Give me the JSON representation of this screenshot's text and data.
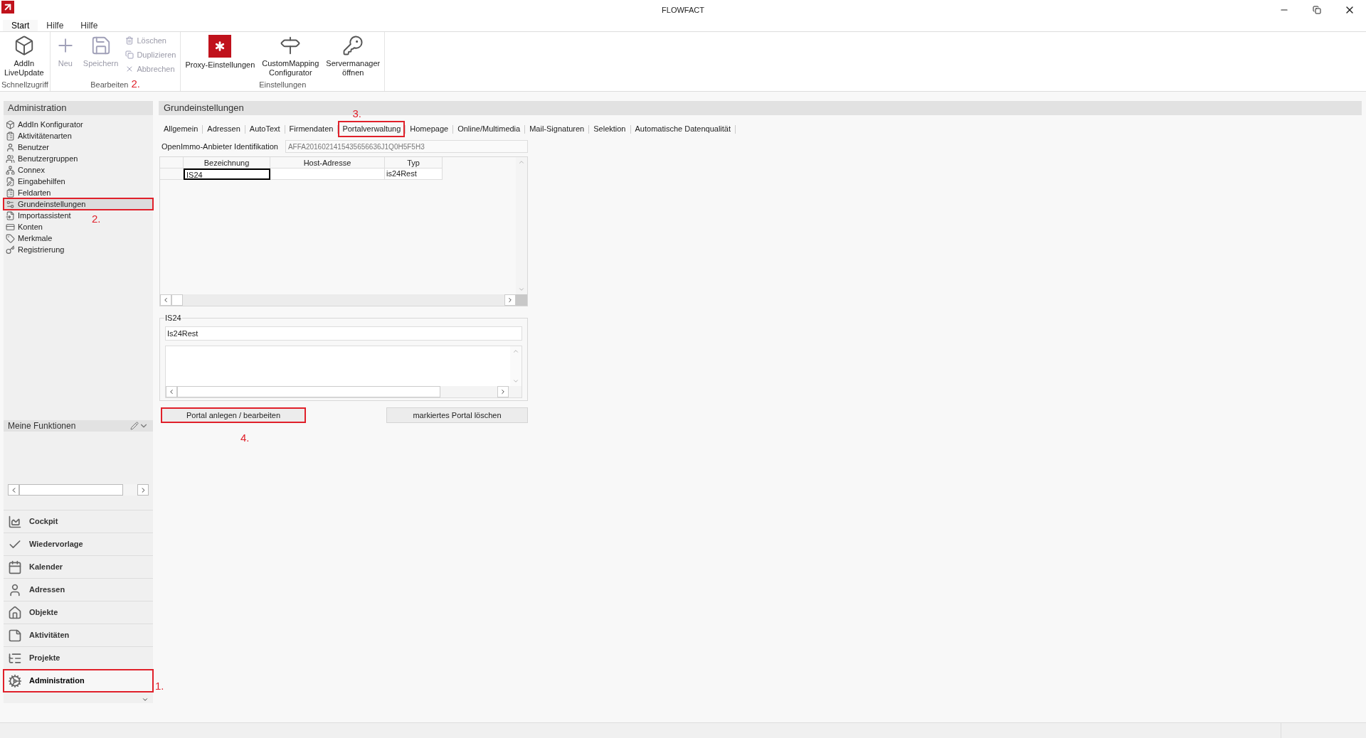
{
  "window": {
    "title": "FLOWFACT"
  },
  "ribbon_tabs": [
    {
      "label": "Start",
      "selected": true
    },
    {
      "label": "Hilfe",
      "selected": false
    },
    {
      "label": "Hilfe",
      "selected": false
    }
  ],
  "ribbon_groups": [
    {
      "label": "Schnellzugriff",
      "buttons": [
        {
          "label": "AddIn\nLiveUpdate",
          "kind": "large",
          "disabled": false
        }
      ]
    },
    {
      "label": "Bearbeiten",
      "marker": "2.",
      "buttons": [
        {
          "label": "Neu",
          "kind": "large",
          "disabled": true
        },
        {
          "label": "Speichern",
          "kind": "large",
          "disabled": true
        },
        {
          "label": "Löschen",
          "kind": "small",
          "disabled": true
        },
        {
          "label": "Duplizieren",
          "kind": "small",
          "disabled": true
        },
        {
          "label": "Abbrechen",
          "kind": "small",
          "disabled": true
        }
      ]
    },
    {
      "label": "Einstellungen",
      "buttons": [
        {
          "label": "Proxy-Einstellungen",
          "kind": "large",
          "disabled": false
        },
        {
          "label": "CustomMapping\nConfigurator",
          "kind": "large",
          "disabled": false
        },
        {
          "label": "Servermanager\nöffnen",
          "kind": "large",
          "disabled": false
        }
      ]
    }
  ],
  "sidebar": {
    "title": "Administration",
    "items": [
      {
        "label": "AddIn Konfigurator",
        "selected": false
      },
      {
        "label": "Aktivitätenarten",
        "selected": false
      },
      {
        "label": "Benutzer",
        "selected": false
      },
      {
        "label": "Benutzergruppen",
        "selected": false
      },
      {
        "label": "Connex",
        "selected": false
      },
      {
        "label": "Eingabehilfen",
        "selected": false
      },
      {
        "label": "Feldarten",
        "selected": false
      },
      {
        "label": "Grundeinstellungen",
        "selected": true,
        "marker": "2."
      },
      {
        "label": "Importassistent",
        "selected": false
      },
      {
        "label": "Konten",
        "selected": false
      },
      {
        "label": "Merkmale",
        "selected": false
      },
      {
        "label": "Registrierung",
        "selected": false
      }
    ]
  },
  "my_functions": {
    "title": "Meine Funktionen"
  },
  "nav": [
    {
      "label": "Cockpit",
      "selected": false
    },
    {
      "label": "Wiedervorlage",
      "selected": false
    },
    {
      "label": "Kalender",
      "selected": false
    },
    {
      "label": "Adressen",
      "selected": false
    },
    {
      "label": "Objekte",
      "selected": false
    },
    {
      "label": "Aktivitäten",
      "selected": false
    },
    {
      "label": "Projekte",
      "selected": false
    },
    {
      "label": "Administration",
      "selected": true,
      "marker": "1."
    }
  ],
  "content": {
    "title": "Grundeinstellungen",
    "tabs": [
      {
        "label": "Allgemein"
      },
      {
        "label": "Adressen"
      },
      {
        "label": "AutoText"
      },
      {
        "label": "Firmendaten"
      },
      {
        "label": "Portalverwaltung",
        "marker": "3."
      },
      {
        "label": "Homepage"
      },
      {
        "label": "Online/Multimedia"
      },
      {
        "label": "Mail-Signaturen"
      },
      {
        "label": "Selektion"
      },
      {
        "label": "Automatische Datenqualität"
      }
    ],
    "provider_id": {
      "label": "OpenImmo-Anbieter Identifikation",
      "value": "AFFA2016021415435656636J1Q0H5F5H3"
    },
    "table": {
      "columns": [
        "Bezeichnung",
        "Host-Adresse",
        "Typ"
      ],
      "rows": [
        {
          "cells": [
            {
              "text": "IS24",
              "focused": true
            },
            {
              "focused": false
            },
            {
              "text": "is24Rest",
              "focused": false
            }
          ]
        }
      ]
    },
    "detail": {
      "legend": "IS24",
      "value": "Is24Rest"
    },
    "buttons": [
      {
        "label": "Portal anlegen / bearbeiten",
        "marker": "4."
      },
      {
        "label": "markiertes Portal löschen"
      }
    ]
  }
}
